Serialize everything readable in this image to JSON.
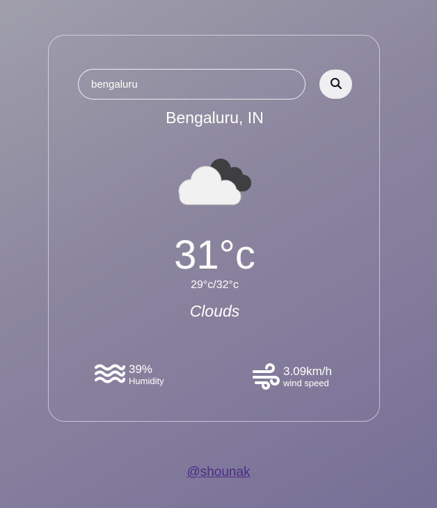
{
  "search": {
    "value": "bengaluru",
    "icon": "search-icon"
  },
  "weather": {
    "location": "Bengaluru, IN",
    "icon": "clouds-icon",
    "temperature": "31°c",
    "min_max": "29°c/32°c",
    "condition": "Clouds"
  },
  "stats": {
    "humidity": {
      "value": "39%",
      "label": "Humidity",
      "icon": "humidity-waves-icon"
    },
    "wind": {
      "value": "3.09km/h",
      "label": "wind speed",
      "icon": "wind-icon"
    }
  },
  "footer": {
    "credit": "@shounak"
  },
  "colors": {
    "background_start": "#a09fab",
    "background_end": "#766f96",
    "link": "#4b2b86",
    "search_button": "#efeff1"
  }
}
